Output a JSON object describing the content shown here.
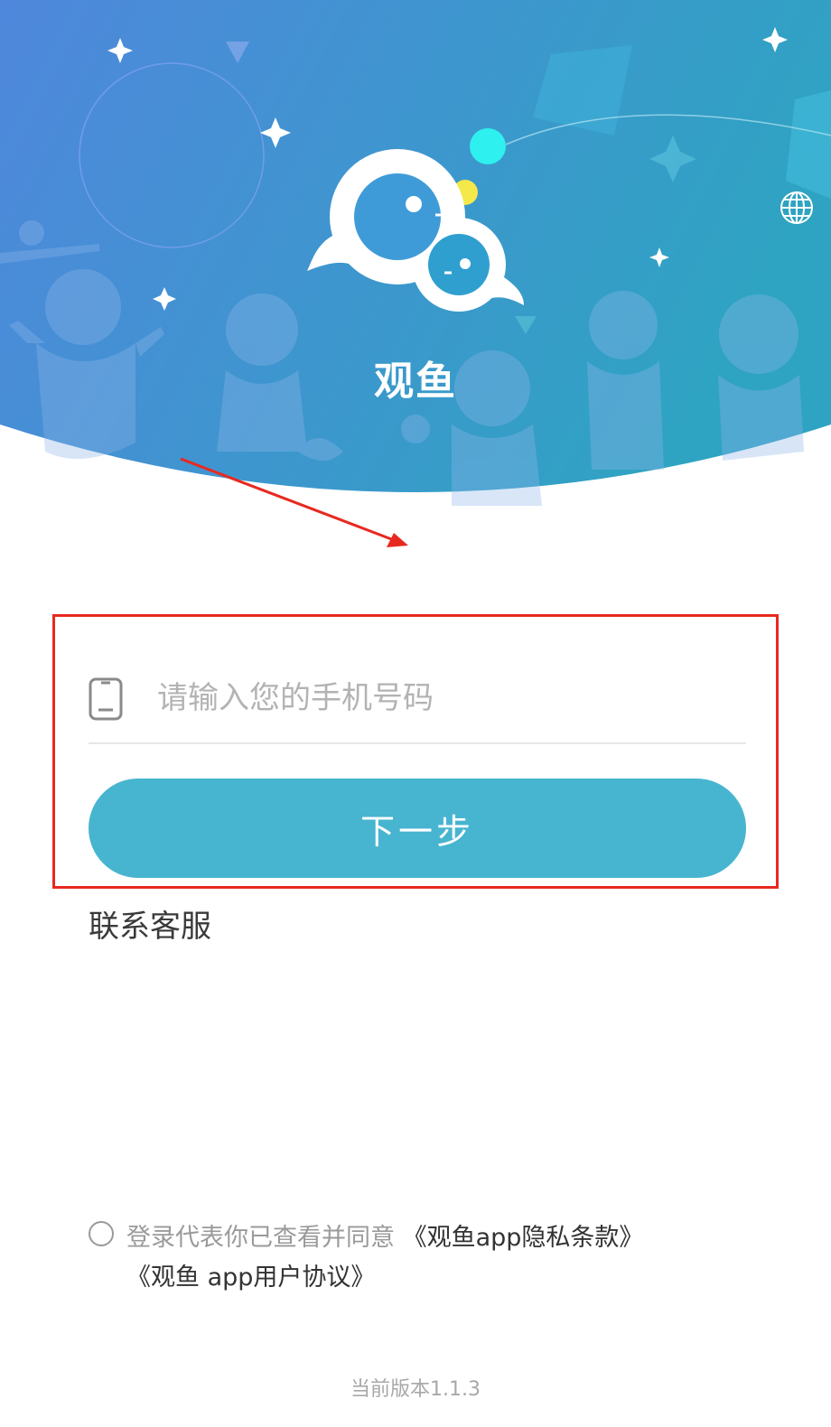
{
  "header": {
    "app_name": "观鱼",
    "colors": {
      "gradient_start": "#4f87dc",
      "gradient_end": "#2fa3c2"
    },
    "language_icon": "globe-icon"
  },
  "login_form": {
    "phone_placeholder": "请输入您的手机号码",
    "phone_value": "",
    "phone_icon": "phone-icon",
    "next_button_label": "下一步",
    "next_button_color": "#47b5d0"
  },
  "contact_label": "联系客服",
  "agreement": {
    "checked": false,
    "prefix_text": "登录代表你已查看并同意 ",
    "privacy_link": "《观鱼app隐私条款》",
    "user_agreement_link": "《观鱼 app用户协议》"
  },
  "version_text": "当前版本1.1.3",
  "annotation": {
    "color": "#e8291f"
  }
}
